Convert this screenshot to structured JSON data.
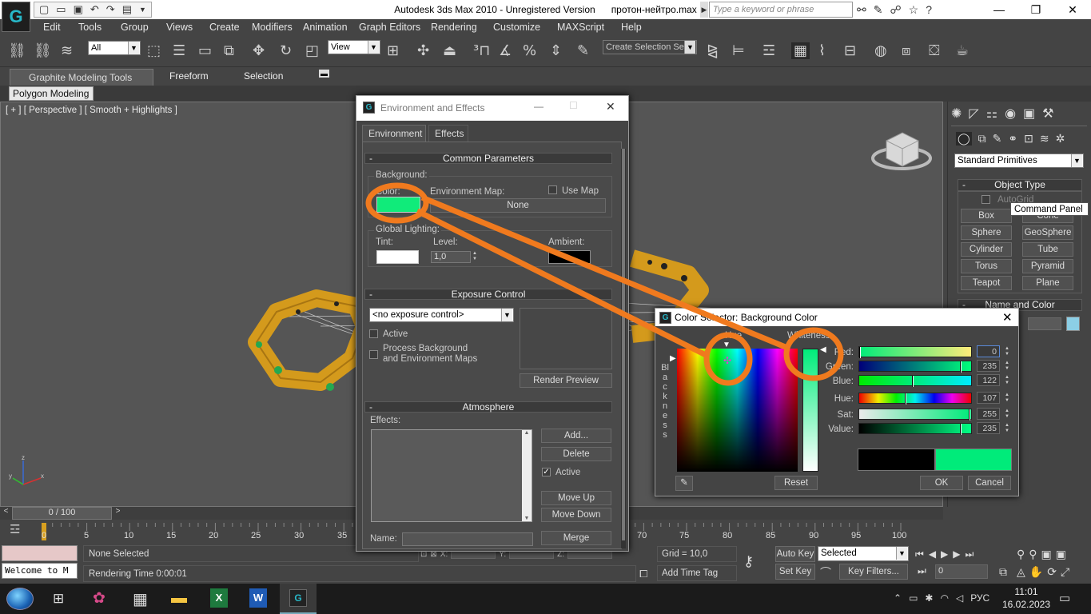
{
  "app": {
    "title": "Autodesk 3ds Max  2010  - Unregistered Version",
    "file": "протон-нейтро.max",
    "search_placeholder": "Type a keyword or phrase"
  },
  "menu": [
    "Edit",
    "Tools",
    "Group",
    "Views",
    "Create",
    "Modifiers",
    "Animation",
    "Graph Editors",
    "Rendering",
    "Customize",
    "MAXScript",
    "Help"
  ],
  "toolbar": {
    "filter_value": "All",
    "refcoord_value": "View",
    "selection_set_value": "Create Selection Se"
  },
  "ribbon": {
    "tabs": [
      "Graphite Modeling Tools",
      "Freeform",
      "Selection"
    ],
    "polygon_modeling": "Polygon Modeling"
  },
  "viewport": {
    "label": "[ + ] [ Perspective ] [ Smooth + Highlights ]",
    "axis_x": "x",
    "axis_y": "y",
    "axis_z": "z"
  },
  "command_panel": {
    "dropdown": "Standard Primitives",
    "object_type_header": "Object Type",
    "autogrid": "AutoGrid",
    "tooltip": "Command Panel",
    "buttons": [
      "Box",
      "Cone",
      "Sphere",
      "GeoSphere",
      "Cylinder",
      "Tube",
      "Torus",
      "Pyramid",
      "Teapot",
      "Plane"
    ],
    "name_color_header": "Name and Color",
    "object_color": "#8ccfe6"
  },
  "env_dialog": {
    "title": "Environment and Effects",
    "tabs": [
      "Environment",
      "Effects"
    ],
    "common_header": "Common Parameters",
    "background_label": "Background:",
    "color_label": "Color:",
    "env_map_label": "Environment Map:",
    "use_map_label": "Use Map",
    "none_button": "None",
    "global_lighting_label": "Global Lighting:",
    "tint_label": "Tint:",
    "level_label": "Level:",
    "level_value": "1,0",
    "ambient_label": "Ambient:",
    "bg_color": "#10eb7a",
    "tint_color": "#ffffff",
    "ambient_color": "#000000",
    "exposure_header": "Exposure Control",
    "exposure_value": "<no exposure control>",
    "active_label": "Active",
    "process_bg_label": "Process Background",
    "process_bg_label2": "and Environment Maps",
    "render_preview": "Render Preview",
    "atmosphere_header": "Atmosphere",
    "effects_label": "Effects:",
    "add_button": "Add...",
    "delete_button": "Delete",
    "active2_label": "Active",
    "move_up": "Move Up",
    "move_down": "Move Down",
    "name_label": "Name:",
    "merge_button": "Merge"
  },
  "color_selector": {
    "title": "Color Selector: Background Color",
    "hue_label": "Hue",
    "whiteness_label": "Whiteness",
    "blackness_label": "Blackness",
    "red_label": "Red:",
    "green_label": "Green:",
    "blue_label": "Blue:",
    "hue2_label": "Hue:",
    "sat_label": "Sat:",
    "value_label": "Value:",
    "red": 0,
    "green": 235,
    "blue": 122,
    "hue": 107,
    "sat": 255,
    "value": 235,
    "old_color": "#000000",
    "new_color": "#00eb7a",
    "reset_button": "Reset",
    "ok_button": "OK",
    "cancel_button": "Cancel"
  },
  "timeline": {
    "frame_display": "0 / 100",
    "ticks": [
      "0",
      "5",
      "10",
      "15",
      "20",
      "25",
      "30",
      "35",
      "70",
      "75",
      "80",
      "85",
      "90",
      "95",
      "100"
    ]
  },
  "status": {
    "maxscript": "Welcome to M",
    "none_selected": "None Selected",
    "rendering_time": "Rendering Time  0:00:01",
    "grid": "Grid = 10,0",
    "add_time_tag": "Add Time Tag",
    "auto_key": "Auto Key",
    "set_key": "Set Key",
    "selected": "Selected",
    "key_filters": "Key Filters...",
    "frame_value": "0",
    "x_label": "X:",
    "y_label": "Y:",
    "z_label": "Z:"
  },
  "taskbar": {
    "lang": "РУС",
    "time": "11:01",
    "date": "16.02.2023"
  },
  "annotation": {
    "color": "#f07a1e"
  }
}
